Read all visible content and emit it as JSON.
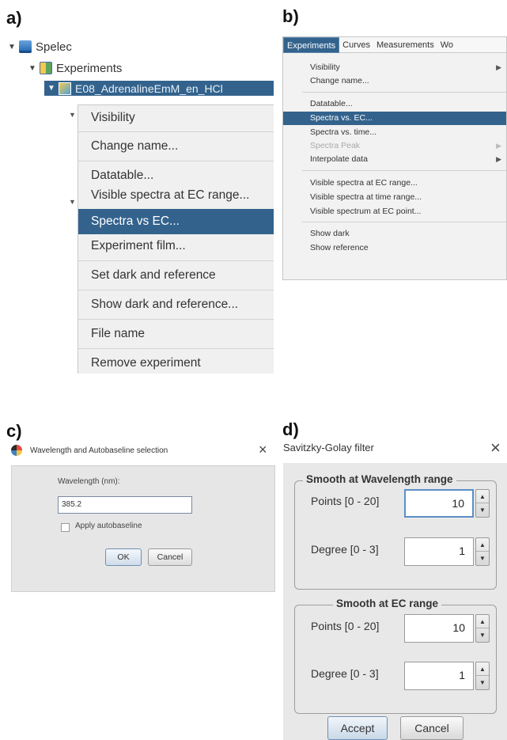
{
  "labels": {
    "a": "a)",
    "b": "b)",
    "c": "c)",
    "d": "d)"
  },
  "panel_a": {
    "tree": {
      "root": "Spelec",
      "experiments": "Experiments",
      "selected_item": "E08_AdrenalineEmM_en_HCl"
    },
    "context_menu": [
      {
        "label": "Visibility"
      },
      {
        "label": "Change name..."
      },
      {
        "label": "Datatable..."
      },
      {
        "label": "Visible spectra at EC range..."
      },
      {
        "label": "Spectra vs EC...",
        "selected": true
      },
      {
        "label": "Experiment film..."
      },
      {
        "label": "Set dark and reference"
      },
      {
        "label": "Show dark and reference..."
      },
      {
        "label": "File name"
      },
      {
        "label": "Remove experiment"
      }
    ]
  },
  "panel_b": {
    "menubar": [
      "Experiments",
      "Curves",
      "Measurements",
      "Wo"
    ],
    "active_menu": "Experiments",
    "items": {
      "visibility": "Visibility",
      "change_name": "Change name...",
      "datatable": "Datatable...",
      "spectra_ec": "Spectra vs. EC...",
      "spectra_time": "Spectra vs. time...",
      "spectra_peak": "Spectra Peak",
      "interpolate": "Interpolate data",
      "vis_ec": "Visible spectra at EC range...",
      "vis_time": "Visible spectra at time range...",
      "vis_point": "Visible spectrum at EC point...",
      "show_dark": "Show dark",
      "show_ref": "Show reference"
    }
  },
  "panel_c": {
    "title": "Wavelength and Autobaseline selection",
    "close": "×",
    "wavelength_label": "Wavelength (nm):",
    "wavelength_value": "385.2",
    "autobaseline_label": "Apply autobaseline",
    "autobaseline_checked": false,
    "ok": "OK",
    "cancel": "Cancel"
  },
  "panel_d": {
    "title": "Savitzky-Golay filter",
    "close": "×",
    "group1": {
      "title": "Smooth at Wavelength range",
      "points_label": "Points [0 - 20]",
      "points_value": "10",
      "degree_label": "Degree [0 - 3]",
      "degree_value": "1"
    },
    "group2": {
      "title": "Smooth at EC range",
      "points_label": "Points [0 - 20]",
      "points_value": "10",
      "degree_label": "Degree [0 - 3]",
      "degree_value": "1"
    },
    "accept": "Accept",
    "cancel": "Cancel"
  },
  "colors": {
    "selection": "#33638d",
    "dialog_bg": "#e8e8e8"
  }
}
